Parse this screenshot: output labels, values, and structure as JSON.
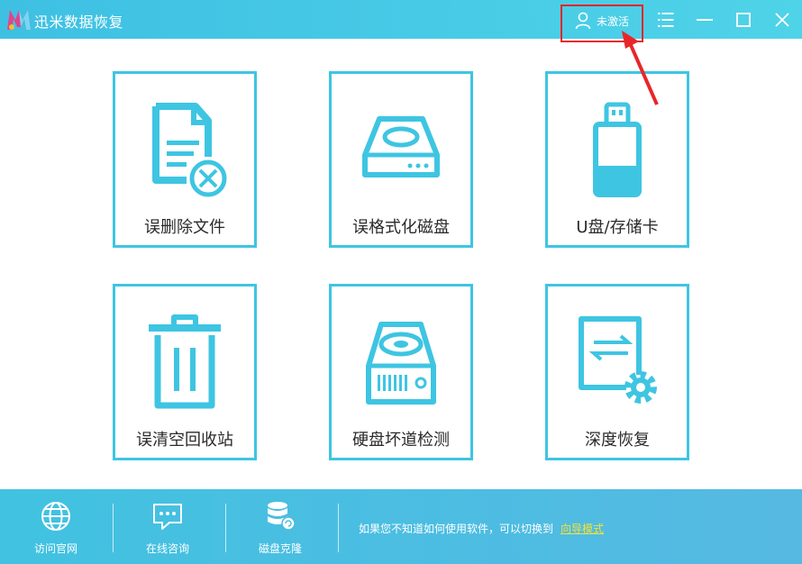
{
  "app": {
    "title": "迅米数据恢复"
  },
  "header": {
    "user_status": "未激活",
    "icons": [
      "user-icon",
      "menu-icon",
      "minimize-icon",
      "maximize-icon",
      "close-icon"
    ]
  },
  "cards": [
    {
      "label": "误删除文件",
      "icon": "deleted-file-icon"
    },
    {
      "label": "误格式化磁盘",
      "icon": "formatted-disk-icon"
    },
    {
      "label": "U盘/存储卡",
      "icon": "usb-drive-icon"
    },
    {
      "label": "误清空回收站",
      "icon": "recycle-bin-icon"
    },
    {
      "label": "硬盘坏道检测",
      "icon": "hard-disk-check-icon"
    },
    {
      "label": "深度恢复",
      "icon": "deep-recovery-icon"
    }
  ],
  "footer": {
    "items": [
      {
        "label": "访问官网",
        "icon": "globe-icon"
      },
      {
        "label": "在线咨询",
        "icon": "chat-icon"
      },
      {
        "label": "磁盘克隆",
        "icon": "database-clone-icon"
      }
    ],
    "hint": "如果您不知道如何使用软件，可以切换到",
    "guide_link": "向导模式"
  },
  "colors": {
    "accent": "#3ec5e2",
    "highlight_border": "#e8262a",
    "link": "#f5e234"
  }
}
